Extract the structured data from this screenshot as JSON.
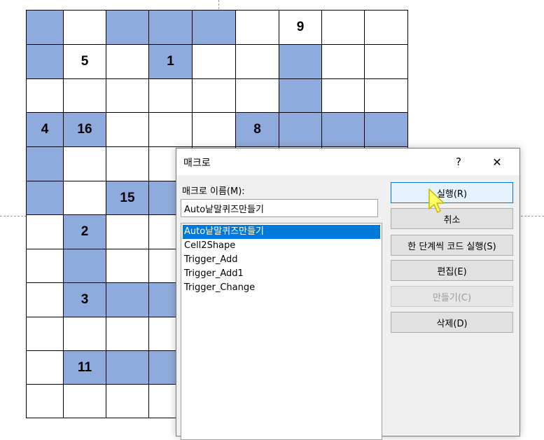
{
  "grid": {
    "rows": [
      [
        {
          "f": true,
          "n": ""
        },
        {
          "f": false,
          "n": ""
        },
        {
          "f": true,
          "n": ""
        },
        {
          "f": true,
          "n": ""
        },
        {
          "f": true,
          "n": ""
        },
        {
          "f": false,
          "n": ""
        },
        {
          "f": false,
          "n": "9"
        },
        {
          "f": false,
          "n": ""
        },
        {
          "f": false,
          "n": ""
        }
      ],
      [
        {
          "f": true,
          "n": ""
        },
        {
          "f": false,
          "n": "5"
        },
        {
          "f": false,
          "n": ""
        },
        {
          "f": true,
          "n": "1"
        },
        {
          "f": false,
          "n": ""
        },
        {
          "f": false,
          "n": ""
        },
        {
          "f": true,
          "n": ""
        },
        {
          "f": false,
          "n": ""
        },
        {
          "f": false,
          "n": ""
        }
      ],
      [
        {
          "f": false,
          "n": ""
        },
        {
          "f": false,
          "n": ""
        },
        {
          "f": false,
          "n": ""
        },
        {
          "f": false,
          "n": ""
        },
        {
          "f": false,
          "n": ""
        },
        {
          "f": false,
          "n": ""
        },
        {
          "f": true,
          "n": ""
        },
        {
          "f": false,
          "n": ""
        },
        {
          "f": false,
          "n": ""
        }
      ],
      [
        {
          "f": true,
          "n": "4"
        },
        {
          "f": true,
          "n": "16"
        },
        {
          "f": false,
          "n": ""
        },
        {
          "f": false,
          "n": ""
        },
        {
          "f": false,
          "n": ""
        },
        {
          "f": true,
          "n": "8"
        },
        {
          "f": true,
          "n": ""
        },
        {
          "f": true,
          "n": ""
        },
        {
          "f": true,
          "n": ""
        }
      ],
      [
        {
          "f": true,
          "n": ""
        },
        {
          "f": false,
          "n": ""
        },
        {
          "f": false,
          "n": ""
        },
        {
          "f": false,
          "n": ""
        },
        {
          "f": false,
          "n": ""
        },
        {
          "f": false,
          "n": ""
        },
        {
          "f": false,
          "n": ""
        },
        {
          "f": false,
          "n": ""
        },
        {
          "f": false,
          "n": ""
        }
      ],
      [
        {
          "f": true,
          "n": ""
        },
        {
          "f": false,
          "n": ""
        },
        {
          "f": true,
          "n": "15"
        },
        {
          "f": true,
          "n": ""
        },
        {
          "f": false,
          "n": ""
        },
        {
          "f": false,
          "n": ""
        },
        {
          "f": false,
          "n": ""
        },
        {
          "f": false,
          "n": ""
        },
        {
          "f": false,
          "n": ""
        }
      ],
      [
        {
          "f": false,
          "n": ""
        },
        {
          "f": true,
          "n": "2"
        },
        {
          "f": false,
          "n": ""
        },
        {
          "f": false,
          "n": ""
        },
        {
          "f": false,
          "n": ""
        },
        {
          "f": false,
          "n": ""
        },
        {
          "f": false,
          "n": ""
        },
        {
          "f": false,
          "n": ""
        },
        {
          "f": false,
          "n": ""
        }
      ],
      [
        {
          "f": false,
          "n": ""
        },
        {
          "f": true,
          "n": ""
        },
        {
          "f": false,
          "n": ""
        },
        {
          "f": false,
          "n": ""
        },
        {
          "f": false,
          "n": ""
        },
        {
          "f": false,
          "n": ""
        },
        {
          "f": false,
          "n": ""
        },
        {
          "f": false,
          "n": ""
        },
        {
          "f": false,
          "n": ""
        }
      ],
      [
        {
          "f": false,
          "n": ""
        },
        {
          "f": true,
          "n": "3"
        },
        {
          "f": true,
          "n": ""
        },
        {
          "f": true,
          "n": ""
        },
        {
          "f": false,
          "n": ""
        },
        {
          "f": false,
          "n": ""
        },
        {
          "f": false,
          "n": ""
        },
        {
          "f": false,
          "n": ""
        },
        {
          "f": false,
          "n": ""
        }
      ],
      [
        {
          "f": false,
          "n": ""
        },
        {
          "f": false,
          "n": ""
        },
        {
          "f": false,
          "n": ""
        },
        {
          "f": false,
          "n": ""
        },
        {
          "f": false,
          "n": ""
        },
        {
          "f": false,
          "n": ""
        },
        {
          "f": false,
          "n": ""
        },
        {
          "f": false,
          "n": ""
        },
        {
          "f": false,
          "n": ""
        }
      ],
      [
        {
          "f": false,
          "n": ""
        },
        {
          "f": true,
          "n": "11"
        },
        {
          "f": true,
          "n": ""
        },
        {
          "f": true,
          "n": ""
        },
        {
          "f": false,
          "n": ""
        },
        {
          "f": false,
          "n": ""
        },
        {
          "f": false,
          "n": ""
        },
        {
          "f": false,
          "n": ""
        },
        {
          "f": false,
          "n": ""
        }
      ],
      [
        {
          "f": false,
          "n": ""
        },
        {
          "f": false,
          "n": ""
        },
        {
          "f": false,
          "n": ""
        },
        {
          "f": false,
          "n": ""
        },
        {
          "f": false,
          "n": ""
        },
        {
          "f": false,
          "n": ""
        },
        {
          "f": false,
          "n": ""
        },
        {
          "f": false,
          "n": ""
        },
        {
          "f": false,
          "n": ""
        }
      ]
    ],
    "colors": {
      "filled": "#8faadc",
      "empty": "#ffffff"
    }
  },
  "dialog": {
    "title": "매크로",
    "help_label": "?",
    "close_label": "✕",
    "name_label": "매크로 이름(M):",
    "name_value": "Auto낱말퀴즈만들기",
    "macros": [
      "Auto낱말퀴즈만들기",
      "Cell2Shape",
      "Trigger_Add",
      "Trigger_Add1",
      "Trigger_Change"
    ],
    "selected_index": 0,
    "buttons": {
      "run": "실행(R)",
      "cancel": "취소",
      "step_into": "한 단계씩 코드 실행(S)",
      "edit": "편집(E)",
      "create": "만들기(C)",
      "delete": "삭제(D)"
    },
    "accent_color": "#0078d7"
  },
  "cursor": {
    "icon": "pointer-cursor-icon",
    "color": "#ffff66"
  }
}
